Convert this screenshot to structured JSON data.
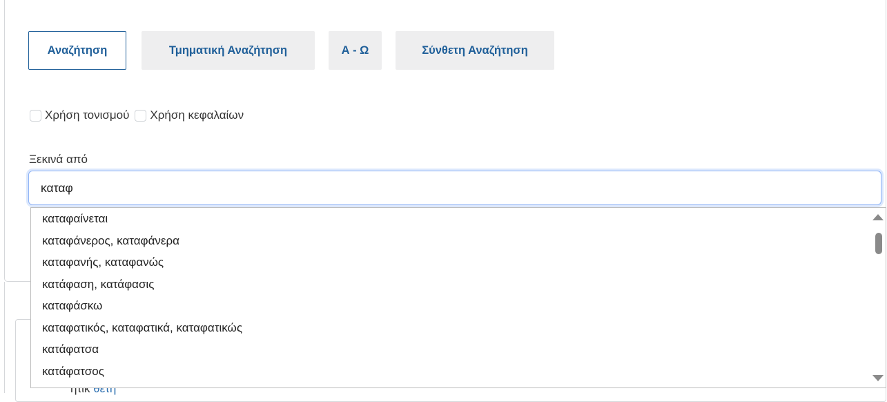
{
  "tabs": [
    {
      "label": "Αναζήτηση",
      "active": true
    },
    {
      "label": "Τμηματική Αναζήτηση",
      "active": false
    },
    {
      "label": "Α - Ω",
      "active": false
    },
    {
      "label": "Σύνθετη Αναζήτηση",
      "active": false
    }
  ],
  "options": {
    "accent_label": "Χρήση τονισμού",
    "caps_label": "Χρήση κεφαλαίων"
  },
  "search": {
    "label": "Ξεκινά από",
    "value": "καταφ"
  },
  "suggestions": [
    "καταφαίνεται",
    "καταφάνερος, καταφάνερα",
    "καταφανής, καταφανώς",
    "κατάφαση, κατάφασις",
    "καταφάσκω",
    "καταφατικός, καταφατικά, καταφατικώς",
    "κατάφατσα",
    "κατάφατσος"
  ],
  "background_text": {
    "prefix": "ητικ",
    "link": "θετή"
  },
  "colors": {
    "accent": "#1f5f99",
    "tab_bg": "#eeeeef",
    "focus_border": "#8fb3f5"
  }
}
